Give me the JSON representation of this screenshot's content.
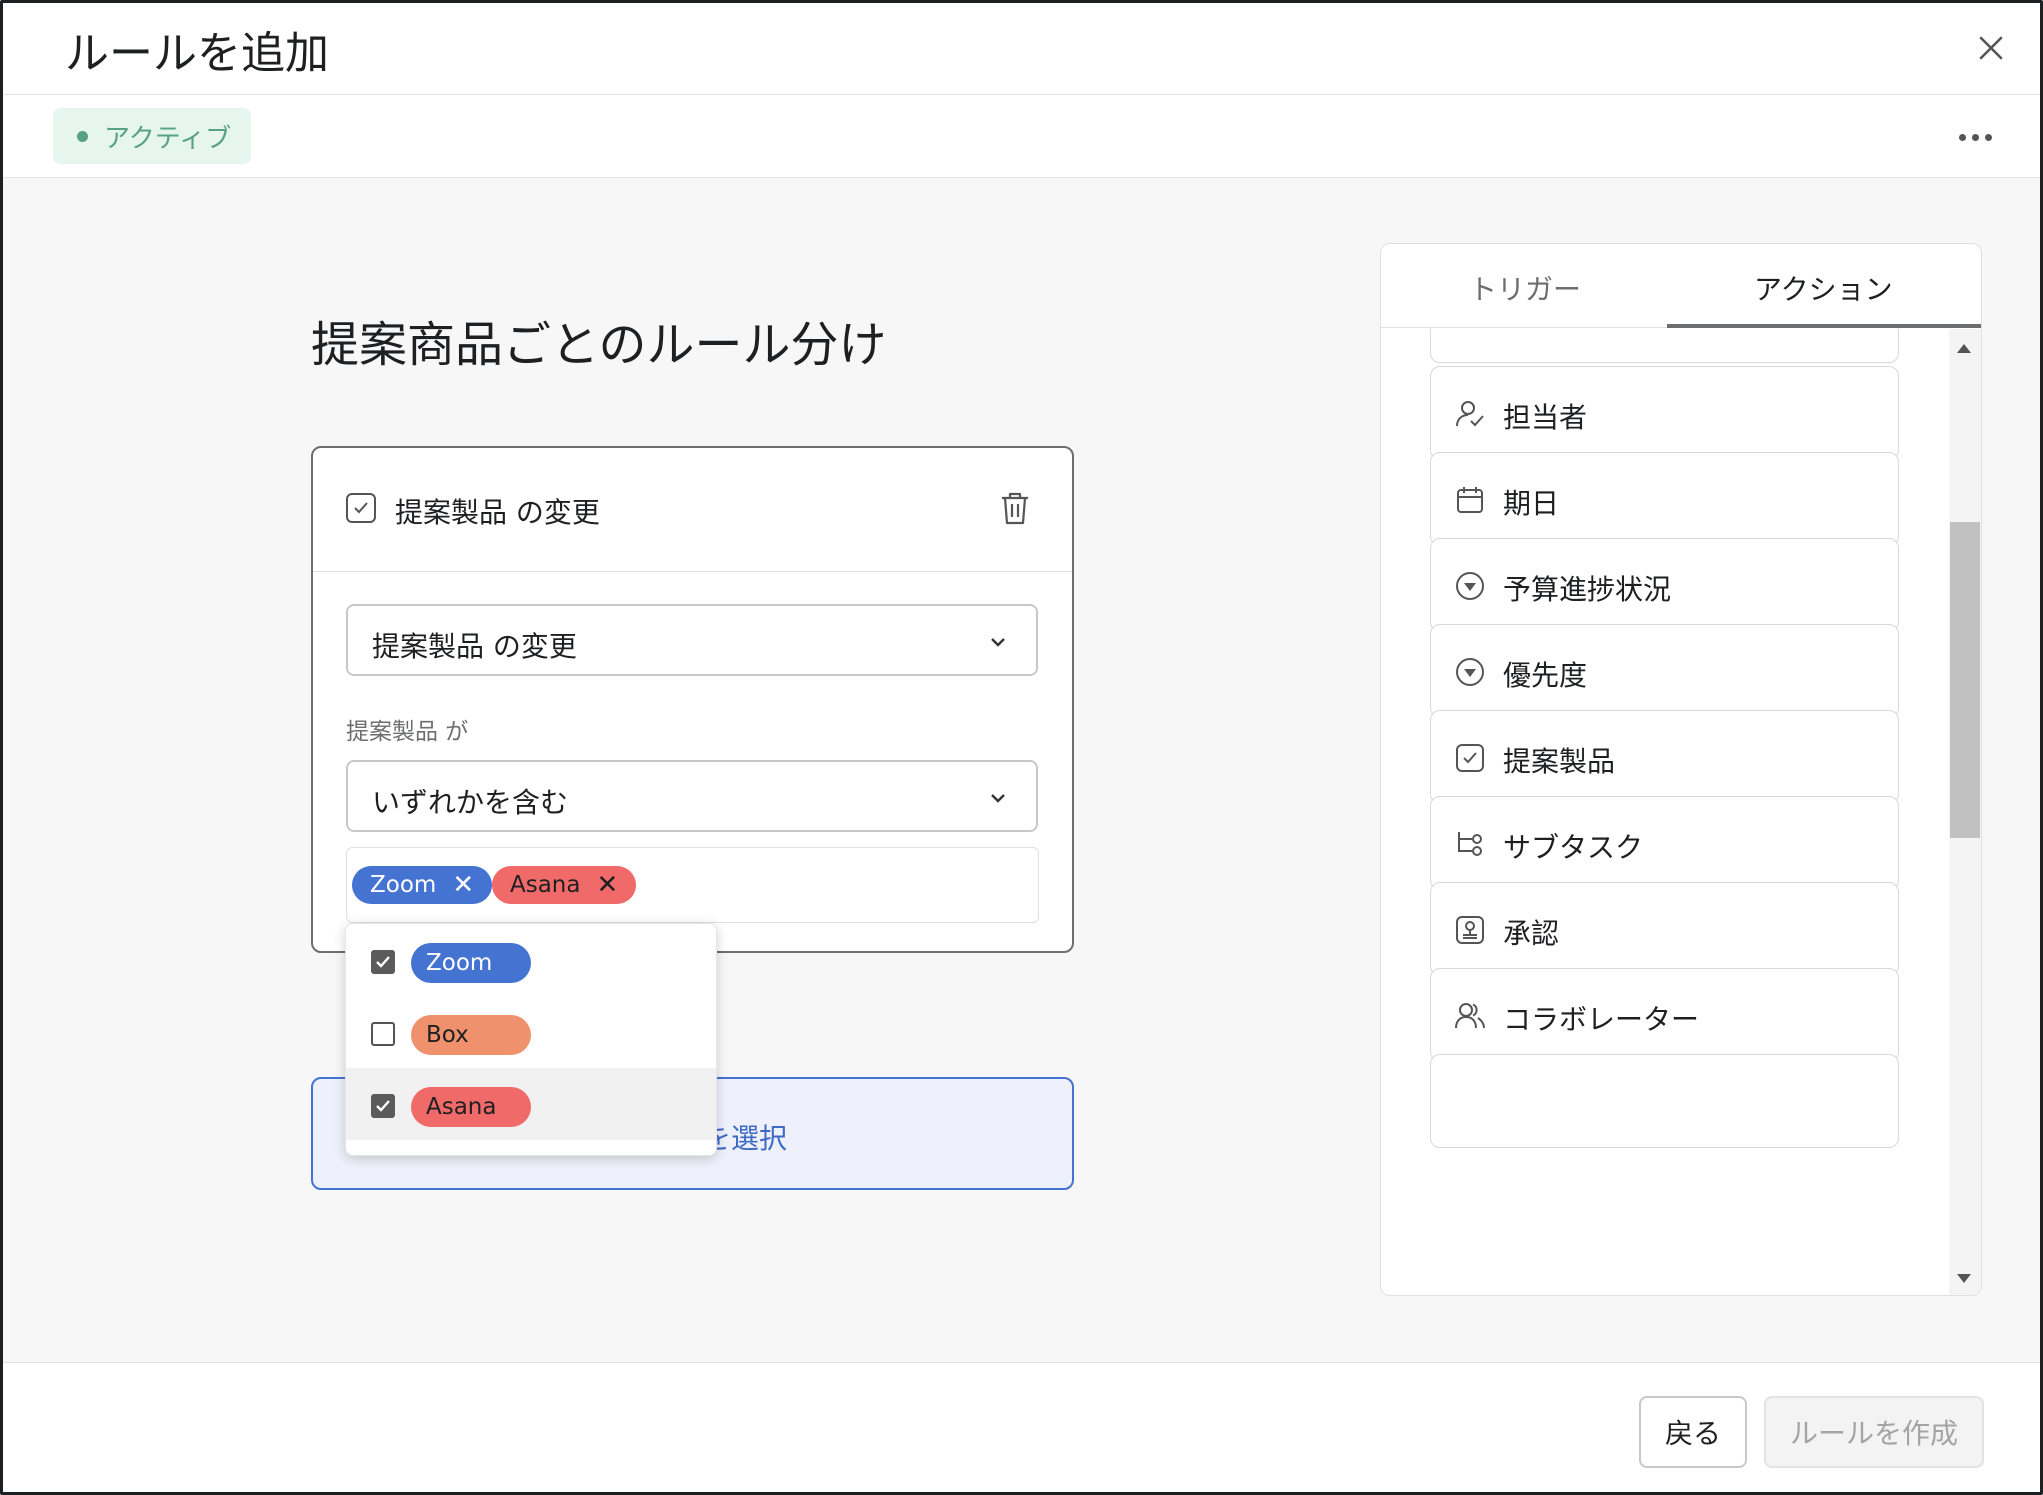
{
  "header": {
    "title": "ルールを追加"
  },
  "status": {
    "label": "アクティブ",
    "color": "#58a183"
  },
  "rule": {
    "name": "提案商品ごとのルール分け"
  },
  "trigger": {
    "title": "提案製品 の変更",
    "select_value": "提案製品 の変更",
    "condition_label": "提案製品 が",
    "condition_value": "いずれかを含む",
    "tags": [
      {
        "label": "Zoom",
        "color": "#4573d2"
      },
      {
        "label": "Asana",
        "color": "#f06a6a"
      }
    ]
  },
  "dropdown": {
    "options": [
      {
        "label": "Zoom",
        "checked": true,
        "color": "#4573d2"
      },
      {
        "label": "Box",
        "checked": false,
        "color": "#f0916d"
      },
      {
        "label": "Asana",
        "checked": true,
        "color": "#f06a6a"
      }
    ]
  },
  "action_box": {
    "text": "を選択"
  },
  "side_panel": {
    "tabs": [
      {
        "label": "トリガー",
        "active": false
      },
      {
        "label": "アクション",
        "active": true
      }
    ],
    "items": [
      {
        "label": "担当者",
        "icon": "assignee-icon"
      },
      {
        "label": "期日",
        "icon": "calendar-icon"
      },
      {
        "label": "予算進捗状況",
        "icon": "dropdown-circle-icon"
      },
      {
        "label": "優先度",
        "icon": "dropdown-circle-icon"
      },
      {
        "label": "提案製品",
        "icon": "checkbox-icon"
      },
      {
        "label": "サブタスク",
        "icon": "subtask-icon"
      },
      {
        "label": "承認",
        "icon": "approval-icon"
      },
      {
        "label": "コラボレーター",
        "icon": "collaborators-icon"
      }
    ]
  },
  "footer": {
    "back_label": "戻る",
    "create_label": "ルールを作成"
  }
}
